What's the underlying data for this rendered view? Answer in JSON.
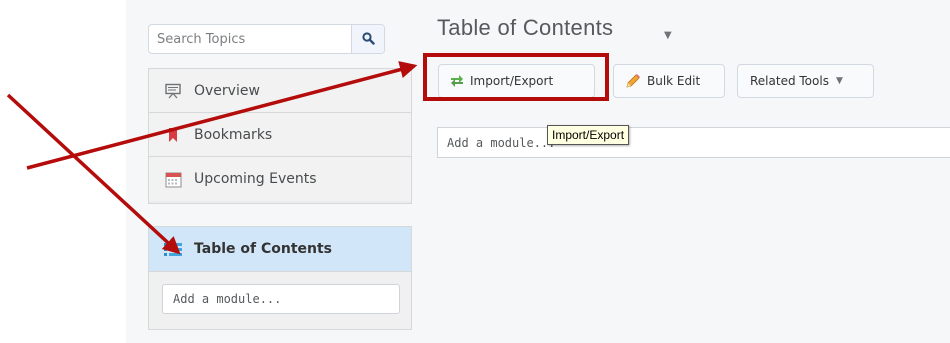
{
  "search": {
    "placeholder": "Search Topics"
  },
  "sidebar": {
    "items": [
      {
        "label": "Overview",
        "icon": "overview-icon"
      },
      {
        "label": "Bookmarks",
        "icon": "bookmark-icon"
      },
      {
        "label": "Upcoming Events",
        "icon": "calendar-icon"
      }
    ],
    "toc": {
      "label": "Table of Contents",
      "icon": "list-icon",
      "add_placeholder": "Add a module..."
    }
  },
  "main": {
    "title": "Table of Contents",
    "toolbar": {
      "import_export": "Import/Export",
      "bulk_edit": "Bulk Edit",
      "related_tools": "Related Tools"
    },
    "add_module": "Add a module...",
    "tooltip": "Import/Export"
  },
  "colors": {
    "annotation": "#b40b0b",
    "toc_highlight": "#d1e6f8"
  }
}
